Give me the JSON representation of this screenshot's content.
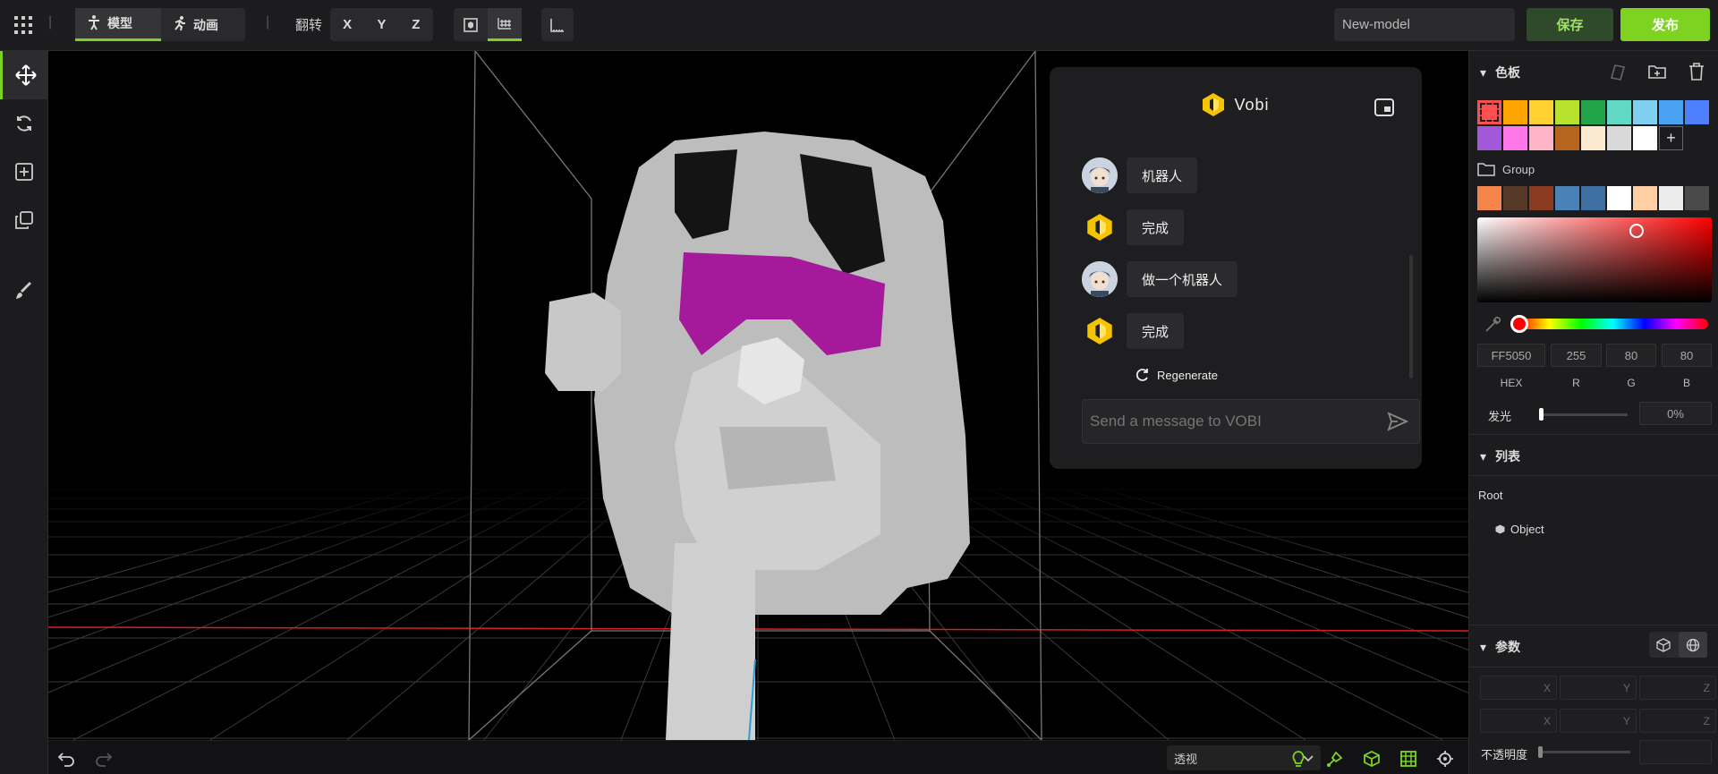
{
  "topbar": {
    "modes": [
      {
        "label": "模型",
        "active": true
      },
      {
        "label": "动画",
        "active": false
      }
    ],
    "flip_label": "翻转",
    "axes": [
      "X",
      "Y",
      "Z"
    ],
    "model_name": "New-model",
    "save_label": "保存",
    "publish_label": "发布",
    "accent": "#7ed321"
  },
  "left_toolbar": {
    "items": [
      "move-tool",
      "rotate-tool",
      "add-tool",
      "duplicate-tool",
      "paint-tool"
    ]
  },
  "chat": {
    "title": "Vobi",
    "messages": [
      {
        "from": "user",
        "text": "机器人"
      },
      {
        "from": "bot",
        "text": "完成"
      },
      {
        "from": "user",
        "text": "做一个机器人"
      },
      {
        "from": "bot",
        "text": "完成"
      }
    ],
    "regenerate_label": "Regenerate",
    "input_placeholder": "Send a message to VOBI"
  },
  "palette": {
    "title": "色板",
    "swatches_row1": [
      "#ff5050",
      "#ffa500",
      "#ffd030",
      "#b7e22e",
      "#21a348",
      "#62d9c4",
      "#7fd0f0",
      "#4aa3f2",
      "#4d7fff"
    ],
    "swatches_row2": [
      "#a259d9",
      "#ff77e9",
      "#ffb3c6",
      "#b5651d",
      "#fde8d0",
      "#d9d9d9",
      "#ffffff"
    ],
    "group_label": "Group",
    "group_swatches": [
      "#f4844a",
      "#553828",
      "#8b3b22",
      "#4a82b8",
      "#3d6fa3",
      "#ffffff",
      "#ffcfa3",
      "#ececec",
      "#4a4a4a"
    ],
    "hex": "FF5050",
    "r": "255",
    "g": "80",
    "b": "80",
    "labels": {
      "hex": "HEX",
      "r": "R",
      "g": "G",
      "b": "B"
    },
    "glow_label": "发光",
    "glow_value": "0%"
  },
  "list": {
    "title": "列表",
    "root": "Root",
    "object": "Object"
  },
  "params": {
    "title": "参数",
    "row1": [
      "X",
      "Y",
      "Z"
    ],
    "row2": [
      "X",
      "Y",
      "Z"
    ],
    "opacity_label": "不透明度"
  },
  "viewport": {
    "view_mode": "透视"
  }
}
